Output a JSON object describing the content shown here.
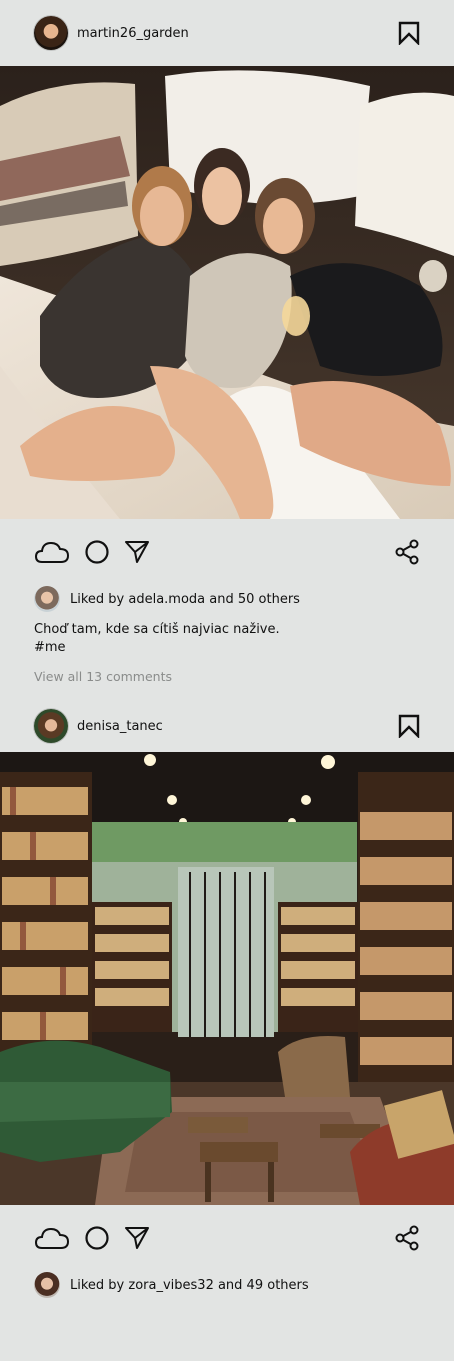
{
  "posts": [
    {
      "username": "martin26_garden",
      "avatar_icon": "user-avatar-photo",
      "photo_description_icon": "friends-on-bed-photo",
      "likes_text": "Liked by adela.moda and 50 others",
      "caption_line1": "Choď tam, kde sa cítiš najviac nažive.",
      "caption_line2": "#me",
      "comments_link": "View all 13 comments"
    },
    {
      "username": "denisa_tanec",
      "avatar_icon": "user-avatar-photo",
      "photo_description_icon": "bookstore-interior-photo",
      "likes_text": "Liked by zora_vibes32 and 49 others"
    }
  ],
  "icons": {
    "like": "cloud-like-icon",
    "comment": "circle-comment-icon",
    "send": "send-arrow-icon",
    "share": "share-icon",
    "save": "bookmark-icon"
  },
  "colors": {
    "background": "#e2e4e3",
    "text": "#111111",
    "muted": "#8a8c8b"
  }
}
